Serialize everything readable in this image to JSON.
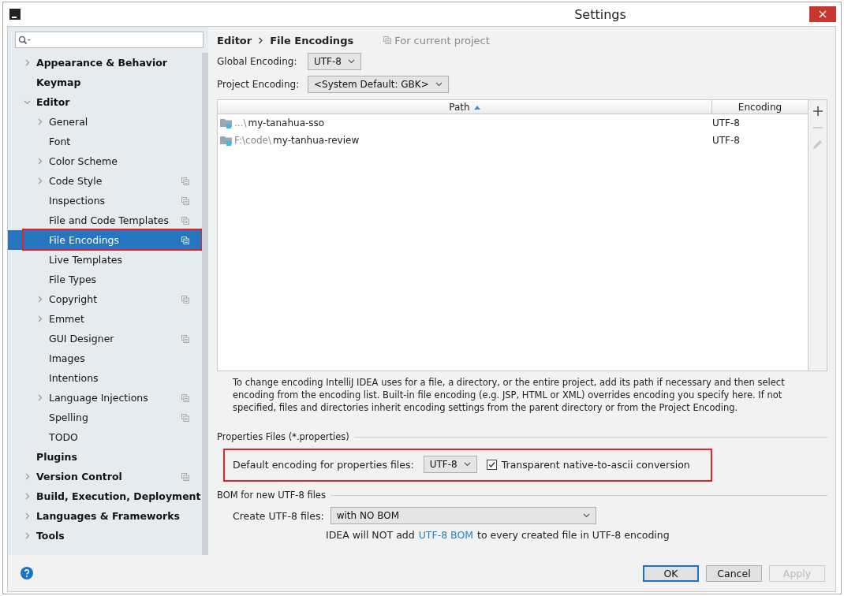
{
  "window": {
    "title": "Settings"
  },
  "sidebar": {
    "tree": [
      {
        "label": "Appearance & Behavior",
        "expanded": false
      },
      {
        "label": "Keymap"
      },
      {
        "label": "Editor",
        "expanded": true,
        "children": [
          {
            "label": "General",
            "expanded": false,
            "selected": false
          },
          {
            "label": "Font",
            "selected": false
          },
          {
            "label": "Color Scheme",
            "expanded": false,
            "selected": false
          },
          {
            "label": "Code Style",
            "expanded": false,
            "project_scope": true,
            "selected": false
          },
          {
            "label": "Inspections",
            "project_scope": true,
            "selected": false
          },
          {
            "label": "File and Code Templates",
            "project_scope": true,
            "selected": false
          },
          {
            "label": "File Encodings",
            "project_scope": true,
            "selected": true,
            "highlighted": true
          },
          {
            "label": "Live Templates",
            "selected": false
          },
          {
            "label": "File Types",
            "selected": false
          },
          {
            "label": "Copyright",
            "expanded": false,
            "project_scope": true,
            "selected": false
          },
          {
            "label": "Emmet",
            "expanded": false,
            "selected": false
          },
          {
            "label": "GUI Designer",
            "project_scope": true,
            "selected": false
          },
          {
            "label": "Images",
            "selected": false
          },
          {
            "label": "Intentions",
            "selected": false
          },
          {
            "label": "Language Injections",
            "expanded": false,
            "project_scope": true,
            "selected": false
          },
          {
            "label": "Spelling",
            "project_scope": true,
            "selected": false
          },
          {
            "label": "TODO",
            "selected": false
          }
        ]
      },
      {
        "label": "Plugins"
      },
      {
        "label": "Version Control",
        "expanded": false,
        "project_scope": true
      },
      {
        "label": "Build, Execution, Deployment",
        "expanded": false
      },
      {
        "label": "Languages & Frameworks",
        "expanded": false
      },
      {
        "label": "Tools",
        "expanded": false
      }
    ]
  },
  "breadcrumb": {
    "parent": "Editor",
    "current": "File Encodings",
    "scope": "For current project"
  },
  "global_encoding": {
    "label": "Global Encoding:",
    "value": "UTF-8"
  },
  "project_encoding": {
    "label": "Project Encoding:",
    "value": "<System Default: GBK>"
  },
  "table": {
    "columns": [
      {
        "label": "Path",
        "sorted": true
      },
      {
        "label": "Encoding",
        "sorted": false
      }
    ],
    "rows": [
      {
        "path_prefix": "...\\",
        "path": "my-tanahua-sso",
        "encoding": "UTF-8"
      },
      {
        "path_prefix": "F:\\code\\",
        "path": "my-tanhua-review",
        "encoding": "UTF-8"
      }
    ],
    "tools": [
      {
        "kind": "add",
        "disabled": false
      },
      {
        "kind": "remove",
        "disabled": true
      },
      {
        "kind": "edit",
        "disabled": true
      }
    ]
  },
  "description": "To change encoding IntelliJ IDEA uses for a file, a directory, or the entire project, add its path if necessary and then select encoding from the encoding list. Built-in file encoding (e.g. JSP, HTML or XML) overrides encoding you specify here. If not specified, files and directories inherit encoding settings from the parent directory or from the Project Encoding.",
  "properties": {
    "title": "Properties Files (*.properties)",
    "highlighted": true,
    "label": "Default encoding for properties files:",
    "value": "UTF-8",
    "transparent": {
      "label": "Transparent native-to-ascii conversion",
      "checked": true
    }
  },
  "bom": {
    "title": "BOM for new UTF-8 files",
    "label": "Create UTF-8 files:",
    "value": "with NO BOM",
    "note_before": "IDEA will NOT add",
    "note_link": "UTF-8 BOM",
    "note_after": "to every created file in UTF-8 encoding"
  },
  "buttons": [
    {
      "label": "OK",
      "kind": "default",
      "disabled": false
    },
    {
      "label": "Cancel",
      "kind": "normal",
      "disabled": false
    },
    {
      "label": "Apply",
      "kind": "normal",
      "disabled": true
    }
  ]
}
